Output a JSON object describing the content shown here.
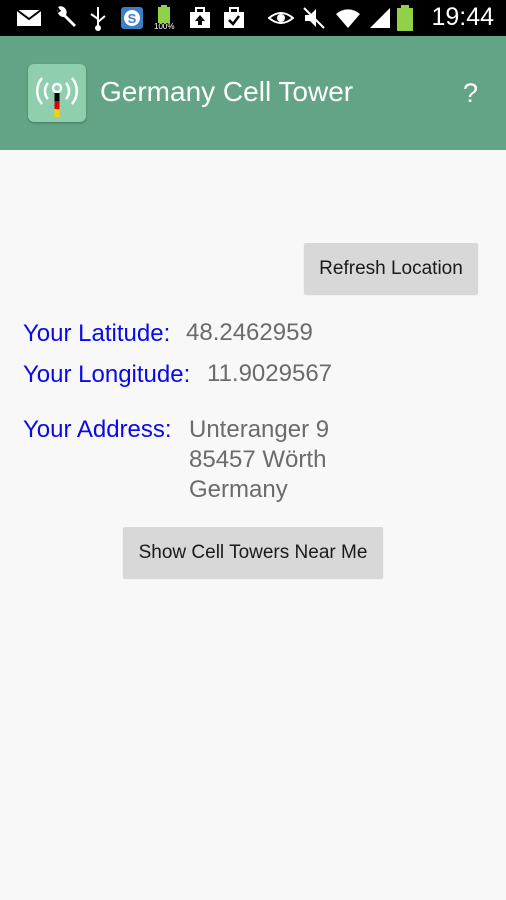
{
  "status_bar": {
    "time": "19:44",
    "battery_small_label": "100%",
    "icons": [
      "mail-icon",
      "wrench-icon",
      "usb-icon",
      "s-app-icon",
      "battery-full-icon",
      "briefcase-upload-icon",
      "briefcase-check-icon",
      "eye-icon",
      "mute-icon",
      "wifi-icon",
      "signal-icon",
      "battery-icon"
    ]
  },
  "app_bar": {
    "title": "Germany Cell Tower",
    "help_label": "?",
    "logo_icon": "cell-tower-germany-flag-icon"
  },
  "actions": {
    "refresh_label": "Refresh Location",
    "show_towers_label": "Show Cell Towers Near Me"
  },
  "location": {
    "latitude_label": "Your Latitude:",
    "latitude": "48.2462959",
    "longitude_label": "Your Longitude:",
    "longitude": "11.9029567",
    "address_label": "Your Address:",
    "address_line1": "Unteranger 9",
    "address_line2": "85457 Wörth",
    "address_line3": "Germany"
  },
  "colors": {
    "app_bar": "#62a485",
    "label": "#0a0ae6",
    "value": "#6b6b6b",
    "button": "#d8d8d8"
  }
}
